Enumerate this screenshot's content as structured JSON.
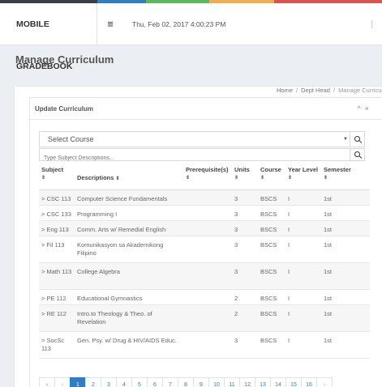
{
  "header": {
    "brand": "MOBILE GRADEBOOK",
    "datetime": "Thu, Feb 02, 2017 4:00:23 PM",
    "color_bar": [
      "#3b3f45",
      "#3b3f45",
      "#2e7fc2",
      "#5cb85c",
      "#f0ad4e",
      "#d9534f",
      "#d9534f"
    ]
  },
  "page": {
    "title": "Manage Curriculum",
    "breadcrumb": [
      "Home",
      "Dept Head",
      "Manage Curriculum"
    ]
  },
  "panel": {
    "title": "Update Curriculum",
    "select_course": "Select Course",
    "search_placeholder": "Type Subject Descriptions...",
    "columns": [
      "Subject",
      "Descriptions",
      "Prerequisite(s)",
      "Units",
      "Course",
      "Year Level",
      "Semester"
    ],
    "rows": [
      {
        "subject": "> CSC 113",
        "description": "Computer Science Fundamentals",
        "prereq": "",
        "units": "3",
        "course": "BSCS",
        "year": "I",
        "semester": "1st"
      },
      {
        "subject": "> CSC 133",
        "description": "Programming I",
        "prereq": "",
        "units": "3",
        "course": "BSCS",
        "year": "I",
        "semester": "1st"
      },
      {
        "subject": "> Eng 113",
        "description": "Comm. Arts w/ Remedial English",
        "prereq": "",
        "units": "3",
        "course": "BSCS",
        "year": "I",
        "semester": "1st"
      },
      {
        "subject": "> Fil 113",
        "description": "Komunikasyon sa Akademikong Filipino",
        "prereq": "",
        "units": "3",
        "course": "BSCS",
        "year": "I",
        "semester": "1st"
      },
      {
        "subject": "> Math 113",
        "description": "College Algebra",
        "prereq": "",
        "units": "3",
        "course": "BSCS",
        "year": "I",
        "semester": "1st"
      },
      {
        "subject": "> PE 112",
        "description": "Educational Gymnastics",
        "prereq": "",
        "units": "2",
        "course": "BSCS",
        "year": "I",
        "semester": "1st"
      },
      {
        "subject": "> RE 112",
        "description": "Intro.to Theology & Theo. of Revelation",
        "prereq": "",
        "units": "2",
        "course": "BSCS",
        "year": "I",
        "semester": "1st"
      },
      {
        "subject": "> SocSc 113",
        "description": "Gen. Psy. w/ Drug & HIV/AIDS Educ.",
        "prereq": "",
        "units": "3",
        "course": "BSCS",
        "year": "I",
        "semester": "1st"
      }
    ],
    "pagination": {
      "first": "«",
      "prev": "‹",
      "pages": [
        "1",
        "2",
        "3",
        "4",
        "5",
        "6",
        "7",
        "8",
        "9",
        "10",
        "11",
        "12",
        "13",
        "14",
        "15",
        "16"
      ],
      "active": "1",
      "next": "›"
    }
  }
}
